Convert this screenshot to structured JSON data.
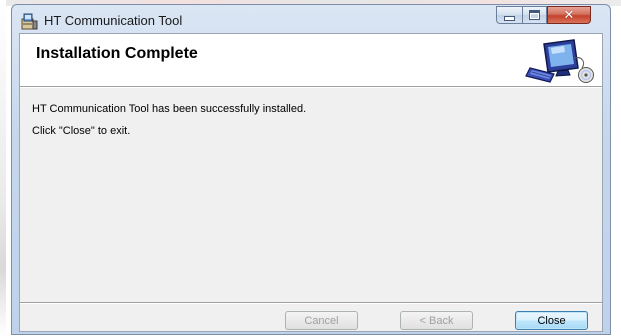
{
  "window": {
    "title": "HT Communication Tool",
    "icon": "installer-app-icon",
    "controls": {
      "minimize_icon": "minimize-icon",
      "maximize_icon": "maximize-icon",
      "close_glyph": "✕"
    }
  },
  "header": {
    "title": "Installation Complete",
    "icon": "computer-setup-icon"
  },
  "body": {
    "message": "HT Communication Tool has been successfully installed.",
    "instruction": "Click \"Close\" to exit."
  },
  "buttons": {
    "cancel": "Cancel",
    "back": "< Back",
    "close": "Close"
  },
  "colors": {
    "frame": "#c6d7ec",
    "client_bg": "#f0f0f0",
    "close_button_accent": "#c4412b",
    "default_button_border": "#3c7fb1"
  }
}
